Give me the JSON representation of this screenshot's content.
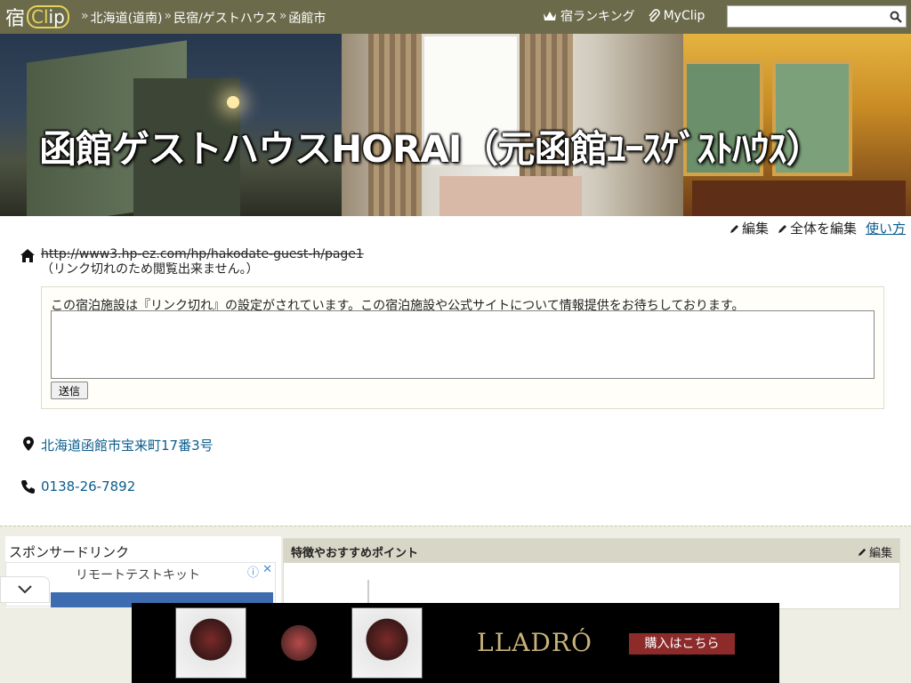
{
  "header": {
    "logo_text": "宿",
    "logo_clip_c": "Cl",
    "logo_clip_ip": "ip",
    "breadcrumbs": [
      "北海道(道南)",
      "民宿/ゲストハウス",
      "函館市"
    ],
    "breadcrumb_sep": "»",
    "ranking_label": "宿ランキング",
    "myclip_label": "MyClip",
    "search_placeholder": ""
  },
  "hero": {
    "title": "函館ゲストハウスHORAI（元函館ﾕｰｽｹﾞｽﾄﾊｳｽ）"
  },
  "edit_bar": {
    "edit_label": "編集",
    "edit_all_label": "全体を編集",
    "howto_label": "使い方"
  },
  "info": {
    "url": "http://www3.hp-ez.com/hp/hakodate-guest-h/page1",
    "url_note": "（リンク切れのため閲覧出来ません。）",
    "notice_message": "この宿泊施設は『リンク切れ』の設定がされています。この宿泊施設や公式サイトについて情報提供をお待ちしております。",
    "send_label": "送信",
    "address": "北海道函館市宝来町17番3号",
    "phone": "0138-26-7892"
  },
  "sidebar": {
    "sponsor_heading": "スポンサードリンク",
    "ad_text": "リモートテストキット"
  },
  "feature": {
    "heading": "特徴やおすすめポイント",
    "edit_label": "編集"
  },
  "bottom_ad": {
    "brand": "LLADRÓ",
    "cta": "購入はこちら"
  },
  "colors": {
    "topbar": "#6b6b4c",
    "link": "#0a5c8c",
    "cta": "#8d2b2b"
  }
}
